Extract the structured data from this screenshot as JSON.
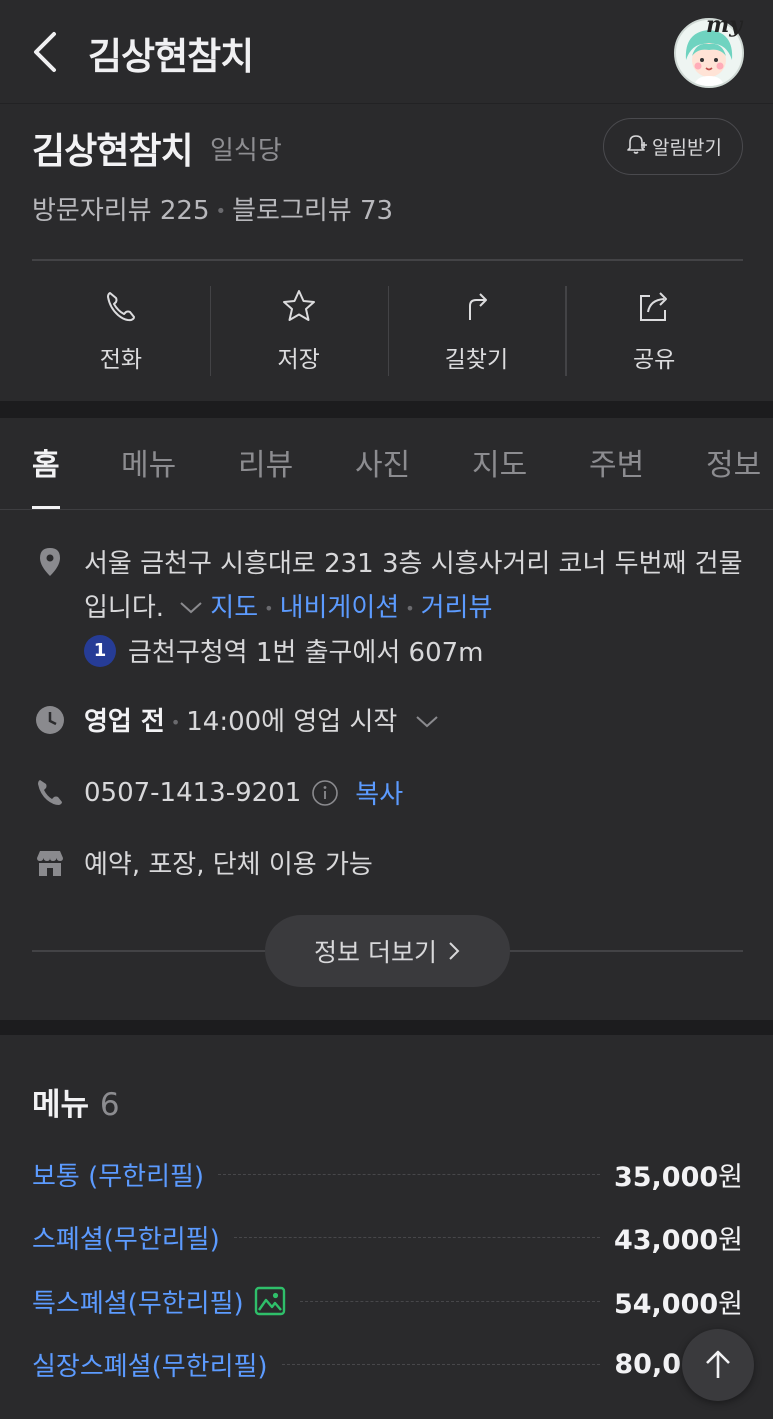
{
  "header": {
    "title": "김상현참치",
    "avatar_badge": "my"
  },
  "place": {
    "name": "김상현참치",
    "category": "일식당",
    "alarm_label": "알림받기",
    "visitor_reviews": "방문자리뷰 225",
    "blog_reviews": "블로그리뷰 73"
  },
  "actions": [
    {
      "icon": "phone-icon",
      "label": "전화"
    },
    {
      "icon": "star-icon",
      "label": "저장"
    },
    {
      "icon": "directions-icon",
      "label": "길찾기"
    },
    {
      "icon": "share-icon",
      "label": "공유"
    }
  ],
  "tabs": [
    "홈",
    "메뉴",
    "리뷰",
    "사진",
    "지도",
    "주변",
    "정보"
  ],
  "active_tab": "홈",
  "info": {
    "address_line": "서울 금천구 시흥대로 231 3층 시흥사거리 코너 두번째 건물입니다.",
    "map_link": "지도",
    "navigation_link": "내비게이션",
    "streetview_link": "거리뷰",
    "subway_line": "1",
    "subway_text": "금천구청역 1번 출구에서 607m",
    "status": "영업 전",
    "hours_text": "14:00에 영업 시작",
    "phone": "0507-1413-9201",
    "copy_label": "복사",
    "facilities": "예약, 포장, 단체 이용 가능",
    "more_label": "정보 더보기"
  },
  "menu": {
    "title": "메뉴",
    "count": "6",
    "items": [
      {
        "name": "보통 (무한리필)",
        "price": "35,000",
        "unit": "원"
      },
      {
        "name": "스폐셜(무한리필)",
        "price": "43,000",
        "unit": "원"
      },
      {
        "name": "특스폐셜(무한리필)",
        "price": "54,000",
        "unit": "원"
      },
      {
        "name": "실장스폐셜(무한리필)",
        "price": "80,0",
        "unit": ""
      }
    ]
  },
  "colors": {
    "background": "#2a2a2c",
    "link": "#5c9bff",
    "subway_line_1": "#263c96"
  }
}
